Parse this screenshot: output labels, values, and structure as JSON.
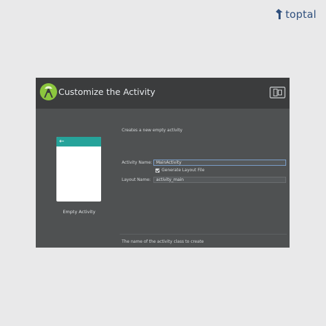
{
  "brand": {
    "name": "toptal"
  },
  "dialog": {
    "title": "Customize the Activity",
    "preview": {
      "label": "Empty Activity",
      "back_icon": "←",
      "accent_color": "#26a39a"
    },
    "description": "Creates a new empty activity",
    "activity_name": {
      "label": "Activity Name:",
      "value": "MainActivity"
    },
    "generate_layout": {
      "label": "Generate Layout File",
      "checked": true
    },
    "layout_name": {
      "label": "Layout Name:",
      "value": "activity_main"
    },
    "hint": "The name of the activity class to create"
  }
}
